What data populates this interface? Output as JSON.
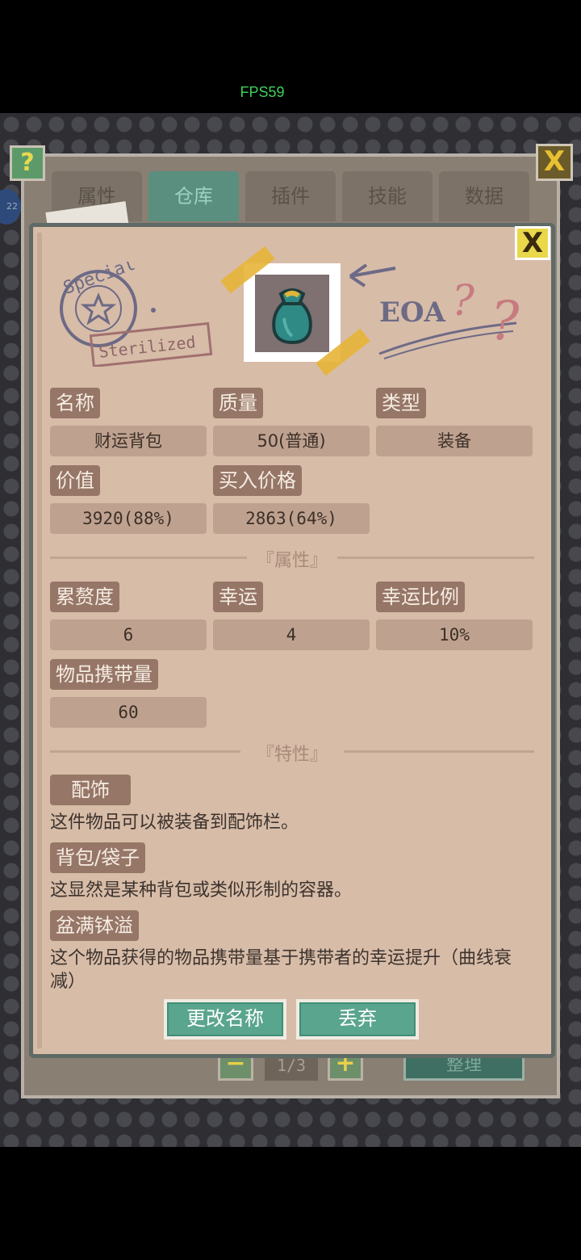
{
  "fps": "FPS59",
  "tabs": [
    "属性",
    "仓库",
    "插件",
    "技能",
    "数据"
  ],
  "help_glyph": "?",
  "close_glyph": "X",
  "level_badge": "22",
  "bottom_bar": {
    "minus": "−",
    "page": "1/3",
    "plus": "+",
    "sort": "整理"
  },
  "item": {
    "fields": {
      "name_label": "名称",
      "name_value": "财运背包",
      "quality_label": "质量",
      "quality_value": "50(普通)",
      "type_label": "类型",
      "type_value": "装备",
      "value_label": "价值",
      "value_value": "3920(88%)",
      "buy_label": "买入价格",
      "buy_value": "2863(64%)"
    },
    "attributes_title": "『属性』",
    "attributes": {
      "burden_label": "累赘度",
      "burden_value": "6",
      "luck_label": "幸运",
      "luck_value": "4",
      "luck_ratio_label": "幸运比例",
      "luck_ratio_value": "10%",
      "carry_label": "物品携带量",
      "carry_value": "60"
    },
    "traits_title": "『特性』",
    "traits": [
      {
        "name": "配饰",
        "desc": "这件物品可以被装备到配饰栏。"
      },
      {
        "name": "背包/袋子",
        "desc": "这显然是某种背包或类似形制的容器。"
      },
      {
        "name": "盆满钵溢",
        "desc": "这个物品获得的物品携带量基于携带者的幸运提升（曲线衰减）"
      }
    ],
    "buttons": {
      "rename": "更改名称",
      "discard": "丢弃"
    },
    "icon": "pouch-icon",
    "stamps": {
      "left_text": "Special",
      "left_sub": "Sterilized",
      "right_text": "EOA"
    }
  },
  "colors": {
    "panel_bg": "#d7bca8",
    "label_bg": "#967667",
    "value_bg": "#bea28f",
    "button_bg": "#5aa58d",
    "tab_active": "#5a8f80"
  }
}
